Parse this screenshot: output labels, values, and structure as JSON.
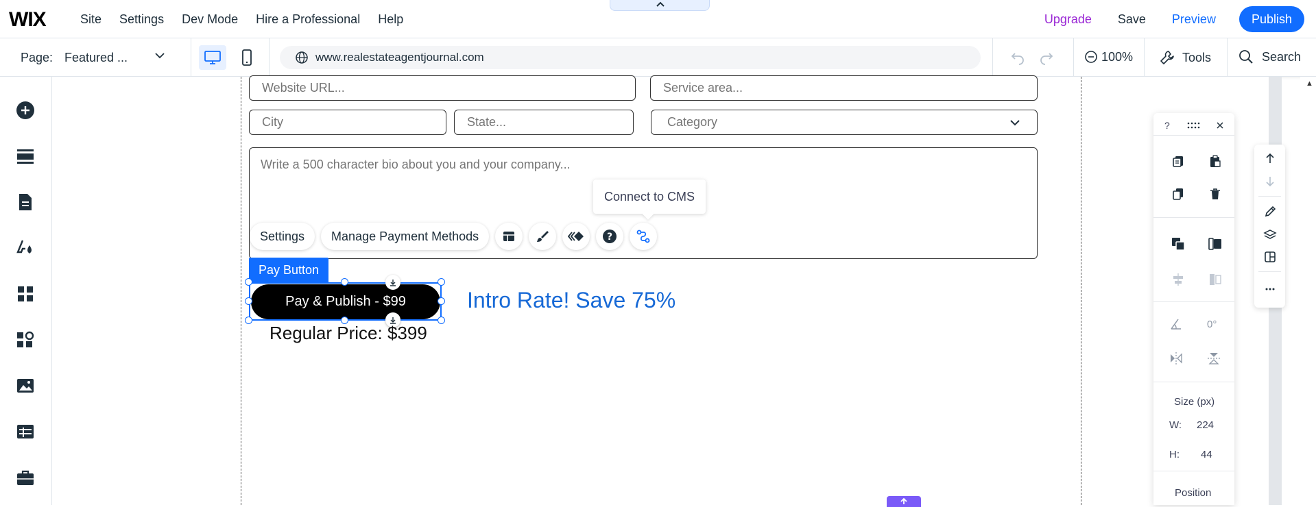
{
  "app": {
    "logo": "WIX"
  },
  "topnav": {
    "items": [
      "Site",
      "Settings",
      "Dev Mode",
      "Hire a Professional",
      "Help"
    ]
  },
  "topright": {
    "upgrade": "Upgrade",
    "save": "Save",
    "preview": "Preview",
    "publish": "Publish"
  },
  "colors": {
    "accent": "#116dff",
    "upgrade": "#9a27d5",
    "intro_text": "#1769d6"
  },
  "secondbar": {
    "page_label": "Page:",
    "page_value": "Featured ...",
    "url": "www.realestateagentjournal.com",
    "zoom": "100%",
    "tools": "Tools",
    "search": "Search"
  },
  "form": {
    "website_placeholder": "Website URL...",
    "service_placeholder": "Service area...",
    "city_placeholder": "City",
    "state_placeholder": "State...",
    "category_value": "Category",
    "bio_placeholder": "Write a 500 character bio about you and your company..."
  },
  "tooltip": {
    "connect_cms": "Connect to CMS"
  },
  "gfpp": {
    "settings": "Settings",
    "manage_payments": "Manage Payment Methods"
  },
  "selection": {
    "label": "Pay Button"
  },
  "pay_button": {
    "label": "Pay & Publish - $99"
  },
  "promo": {
    "intro": "Intro Rate! Save 75%",
    "regular": "Regular Price: $399"
  },
  "inspector": {
    "help": "?",
    "rotation": "0°",
    "size_title": "Size (px)",
    "w_label": "W:",
    "w_value": "224",
    "h_label": "H:",
    "h_value": "44",
    "position_title": "Position"
  }
}
